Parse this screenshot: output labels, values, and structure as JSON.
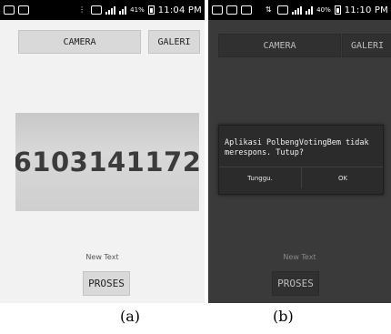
{
  "screens": [
    {
      "status_time": "11:04 PM",
      "battery_pct": "41%",
      "camera_label": "CAMERA",
      "galeri_label": "GALERI",
      "photo_number": "6103141172",
      "new_text_label": "New Text",
      "proses_label": "PROSES",
      "caption": "(a)"
    },
    {
      "status_time": "11:10 PM",
      "battery_pct": "40%",
      "camera_label": "CAMERA",
      "galeri_label": "GALERI",
      "dialog": {
        "message": "Aplikasi PolbengVotingBem tidak merespons. Tutup?",
        "wait_label": "Tunggu.",
        "ok_label": "OK"
      },
      "new_text_label": "New Text",
      "proses_label": "PROSES",
      "caption": "(b)"
    }
  ],
  "colors": {
    "screen_a_bg": "#f2f2f2",
    "screen_b_dim_bg": "#3a3a3a",
    "button_bg": "#d9d9d9",
    "dialog_bg": "#2b2b2b"
  }
}
